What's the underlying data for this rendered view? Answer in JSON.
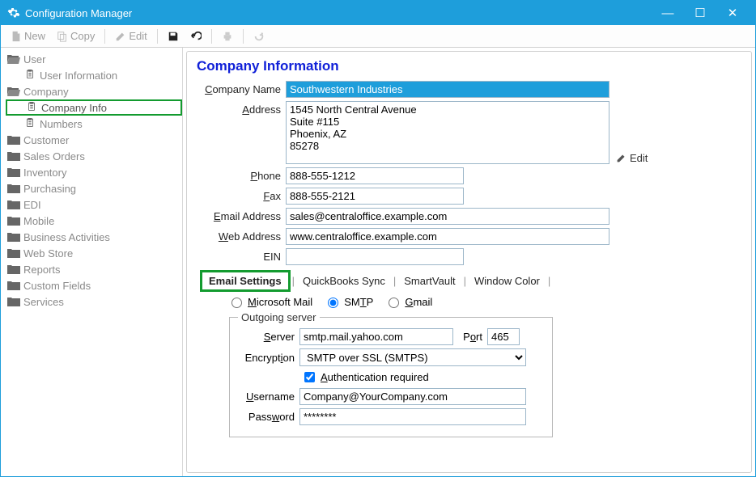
{
  "window": {
    "title": "Configuration Manager"
  },
  "toolbar": {
    "new": "New",
    "copy": "Copy",
    "edit": "Edit"
  },
  "sidebar": {
    "items": [
      {
        "label": "User",
        "type": "folder-open"
      },
      {
        "label": "User Information",
        "type": "leaf"
      },
      {
        "label": "Company",
        "type": "folder-open"
      },
      {
        "label": "Company Info",
        "type": "leaf",
        "hl": true
      },
      {
        "label": "Numbers",
        "type": "leaf"
      },
      {
        "label": "Customer",
        "type": "folder"
      },
      {
        "label": "Sales Orders",
        "type": "folder"
      },
      {
        "label": "Inventory",
        "type": "folder"
      },
      {
        "label": "Purchasing",
        "type": "folder"
      },
      {
        "label": "EDI",
        "type": "folder"
      },
      {
        "label": "Mobile",
        "type": "folder"
      },
      {
        "label": "Business Activities",
        "type": "folder"
      },
      {
        "label": "Web Store",
        "type": "folder"
      },
      {
        "label": "Reports",
        "type": "folder"
      },
      {
        "label": "Custom Fields",
        "type": "folder"
      },
      {
        "label": "Services",
        "type": "folder"
      }
    ]
  },
  "content": {
    "heading": "Company Information",
    "labels": {
      "company_name": "Company Name",
      "address": "Address",
      "phone": "Phone",
      "fax": "Fax",
      "email": "Email Address",
      "web": "Web Address",
      "ein": "EIN",
      "edit": "Edit"
    },
    "values": {
      "company_name": "Southwestern Industries",
      "address": "1545 North Central Avenue\nSuite #115\nPhoenix, AZ\n85278",
      "phone": "888-555-1212",
      "fax": "888-555-2121",
      "email": "sales@centraloffice.example.com",
      "web": "www.centraloffice.example.com",
      "ein": ""
    },
    "tabs": [
      "Email Settings",
      "QuickBooks Sync",
      "SmartVault",
      "Window Color"
    ],
    "active_tab": 0,
    "email": {
      "radios": {
        "ms": "Microsoft Mail",
        "smtp": "SMTP",
        "gmail": "Gmail",
        "selected": "smtp"
      },
      "fieldset": "Outgoing server",
      "labels": {
        "server": "Server",
        "port": "Port",
        "encryption": "Encryption",
        "auth": "Authentication required",
        "username": "Username",
        "password": "Password"
      },
      "values": {
        "server": "smtp.mail.yahoo.com",
        "port": "465",
        "encryption": "SMTP over SSL (SMTPS)",
        "auth": true,
        "username": "Company@YourCompany.com",
        "password": "********"
      }
    }
  }
}
